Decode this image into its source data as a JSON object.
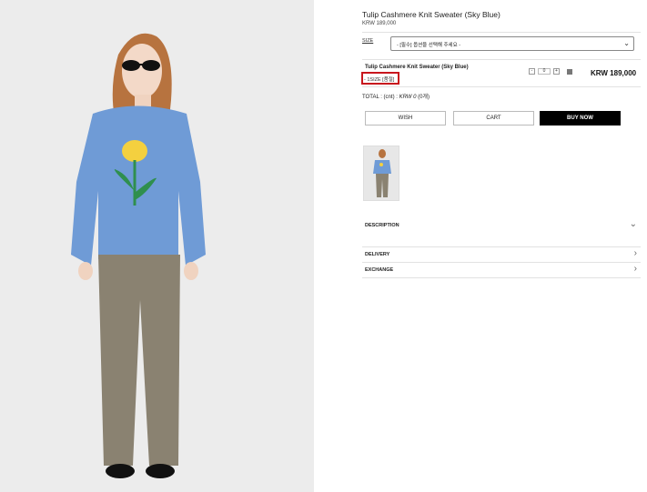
{
  "product": {
    "title": "Tulip Cashmere Knit Sweater (Sky Blue)",
    "price": "KRW 189,000"
  },
  "size_field": {
    "label": "SIZE",
    "selected": "- [필수] 옵션을 선택해 주세요 -"
  },
  "selected_option": {
    "name": "Tulip Cashmere Knit Sweater (Sky Blue)",
    "size": "- 1SIZE [품절]",
    "quantity": "0",
    "minus": "-",
    "plus": "+",
    "price": "KRW 189,000"
  },
  "total": {
    "label": "TOTAL : (cnt) :",
    "amount": "KRW 0",
    "count": "(0개)"
  },
  "actions": {
    "wish": "WISH",
    "cart": "CART",
    "buy": "BUY NOW"
  },
  "sections": {
    "description": "DESCRIPTION",
    "delivery": "DELIVERY",
    "exchange": "EXCHANGE"
  },
  "icons": {
    "select_chevron": "chevron-down-icon",
    "description_chevron": "chevron-down-icon",
    "delivery_chevron": "chevron-right-icon",
    "exchange_chevron": "chevron-right-icon"
  },
  "colors": {
    "highlight_border": "#c8161d",
    "buy_button": "#000000",
    "sweater": "#6f9bd6",
    "pants": "#8a8271"
  }
}
